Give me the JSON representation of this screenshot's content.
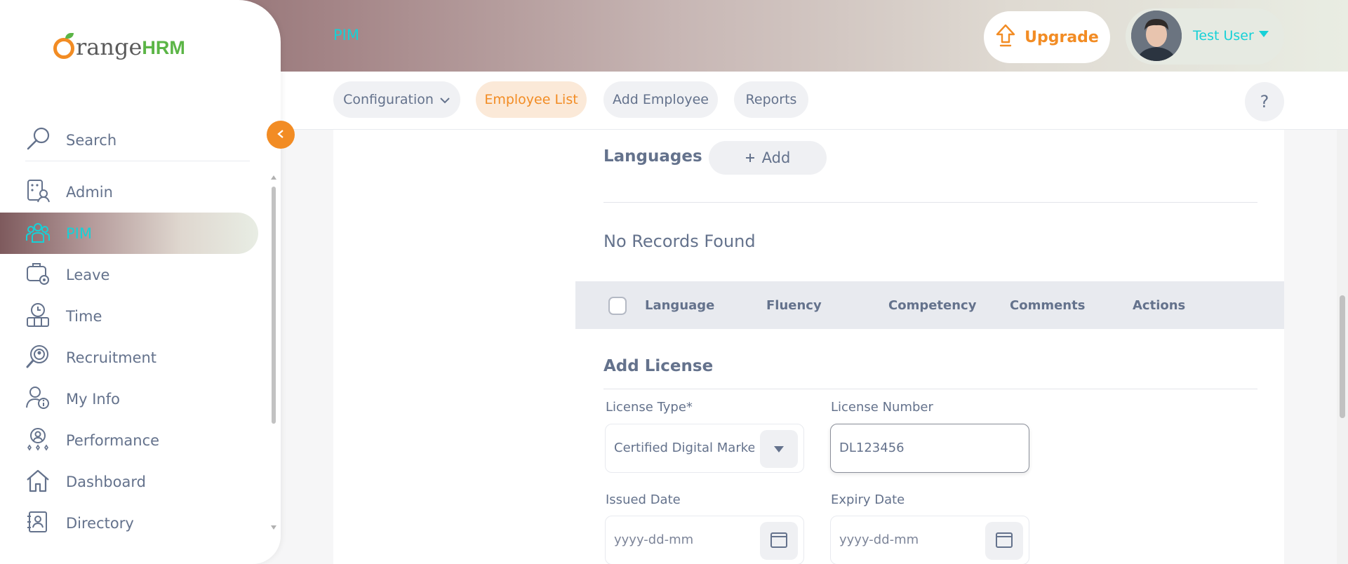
{
  "header": {
    "module_title": "PIM",
    "upgrade_label": "Upgrade",
    "user_name": "Test User"
  },
  "logo": {
    "text_orange": "range",
    "text_hrm": "HRM"
  },
  "subnav": {
    "items": [
      {
        "label": "Configuration",
        "has_dropdown": true
      },
      {
        "label": "Employee List",
        "active": true
      },
      {
        "label": "Add Employee"
      },
      {
        "label": "Reports"
      }
    ],
    "help_label": "?"
  },
  "sidebar": {
    "search_label": "Search",
    "items": [
      {
        "label": "Admin",
        "icon": "admin-icon"
      },
      {
        "label": "PIM",
        "icon": "pim-icon",
        "active": true
      },
      {
        "label": "Leave",
        "icon": "leave-icon"
      },
      {
        "label": "Time",
        "icon": "time-icon"
      },
      {
        "label": "Recruitment",
        "icon": "recruitment-icon"
      },
      {
        "label": "My Info",
        "icon": "myinfo-icon"
      },
      {
        "label": "Performance",
        "icon": "performance-icon"
      },
      {
        "label": "Dashboard",
        "icon": "dashboard-icon"
      },
      {
        "label": "Directory",
        "icon": "directory-icon"
      }
    ]
  },
  "languages": {
    "title": "Languages",
    "add_label": "Add",
    "empty_text": "No Records Found",
    "columns": [
      "Language",
      "Fluency",
      "Competency",
      "Comments",
      "Actions"
    ]
  },
  "license": {
    "title": "Add License",
    "type_label": "License Type*",
    "type_value": "Certified Digital Marke...",
    "number_label": "License Number",
    "number_value": "DL123456",
    "issued_label": "Issued Date",
    "issued_placeholder": "yyyy-dd-mm",
    "expiry_label": "Expiry Date",
    "expiry_placeholder": "yyyy-dd-mm"
  },
  "colors": {
    "accent_orange": "#f28c24",
    "accent_cyan": "#16d1d7",
    "text_gray": "#64728c"
  }
}
